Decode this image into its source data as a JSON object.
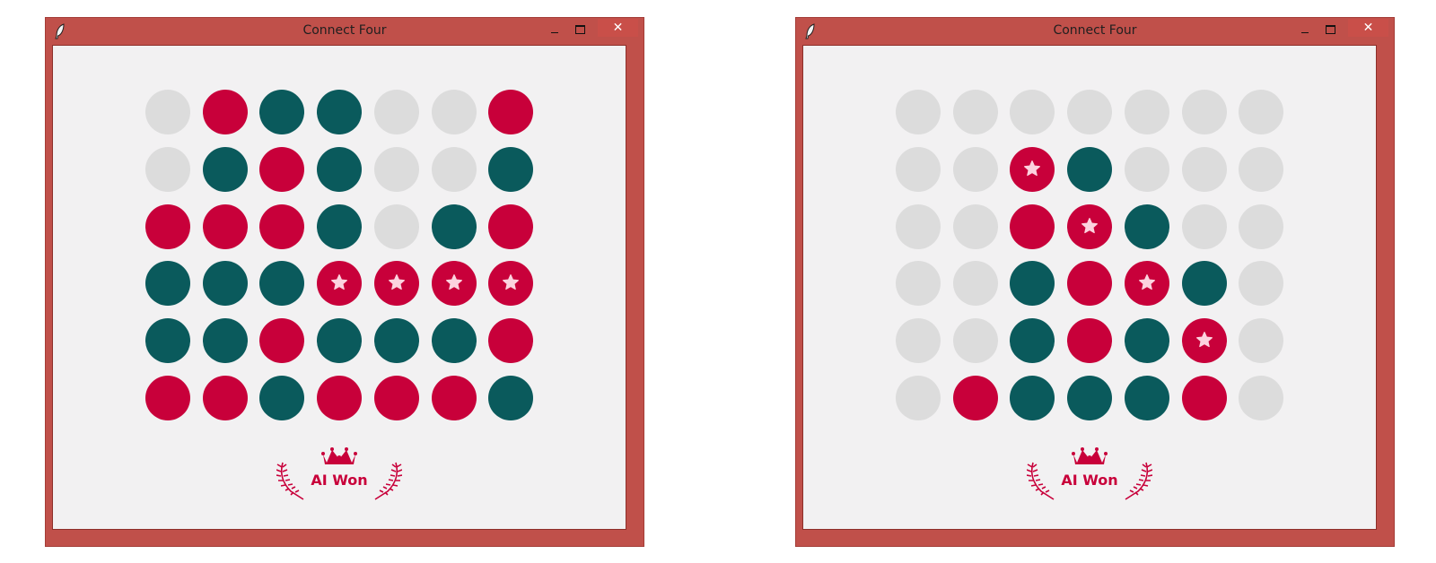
{
  "colors": {
    "player": "#c8003a",
    "ai": "#0a5a5c",
    "empty": "#dcdcdc",
    "star": "#fcd3df"
  },
  "windows": [
    {
      "title": "Connect Four",
      "close_label": "✕",
      "result_label": "AI Won",
      "board": [
        [
          "empty",
          "red",
          "teal",
          "teal",
          "empty",
          "empty",
          "red"
        ],
        [
          "empty",
          "teal",
          "red",
          "teal",
          "empty",
          "empty",
          "teal"
        ],
        [
          "red",
          "red",
          "red",
          "teal",
          "empty",
          "teal",
          "red"
        ],
        [
          "teal",
          "teal",
          "teal",
          "red-star",
          "red-star",
          "red-star",
          "red-star"
        ],
        [
          "teal",
          "teal",
          "red",
          "teal",
          "teal",
          "teal",
          "red"
        ],
        [
          "red",
          "red",
          "teal",
          "red",
          "red",
          "red",
          "teal"
        ]
      ]
    },
    {
      "title": "Connect Four",
      "close_label": "✕",
      "result_label": "AI Won",
      "board": [
        [
          "empty",
          "empty",
          "empty",
          "empty",
          "empty",
          "empty",
          "empty"
        ],
        [
          "empty",
          "empty",
          "red-star",
          "teal",
          "empty",
          "empty",
          "empty"
        ],
        [
          "empty",
          "empty",
          "red",
          "red-star",
          "teal",
          "empty",
          "empty"
        ],
        [
          "empty",
          "empty",
          "teal",
          "red",
          "red-star",
          "teal",
          "empty"
        ],
        [
          "empty",
          "empty",
          "teal",
          "red",
          "teal",
          "red-star",
          "empty"
        ],
        [
          "empty",
          "red",
          "teal",
          "teal",
          "teal",
          "red",
          "empty"
        ]
      ]
    }
  ]
}
